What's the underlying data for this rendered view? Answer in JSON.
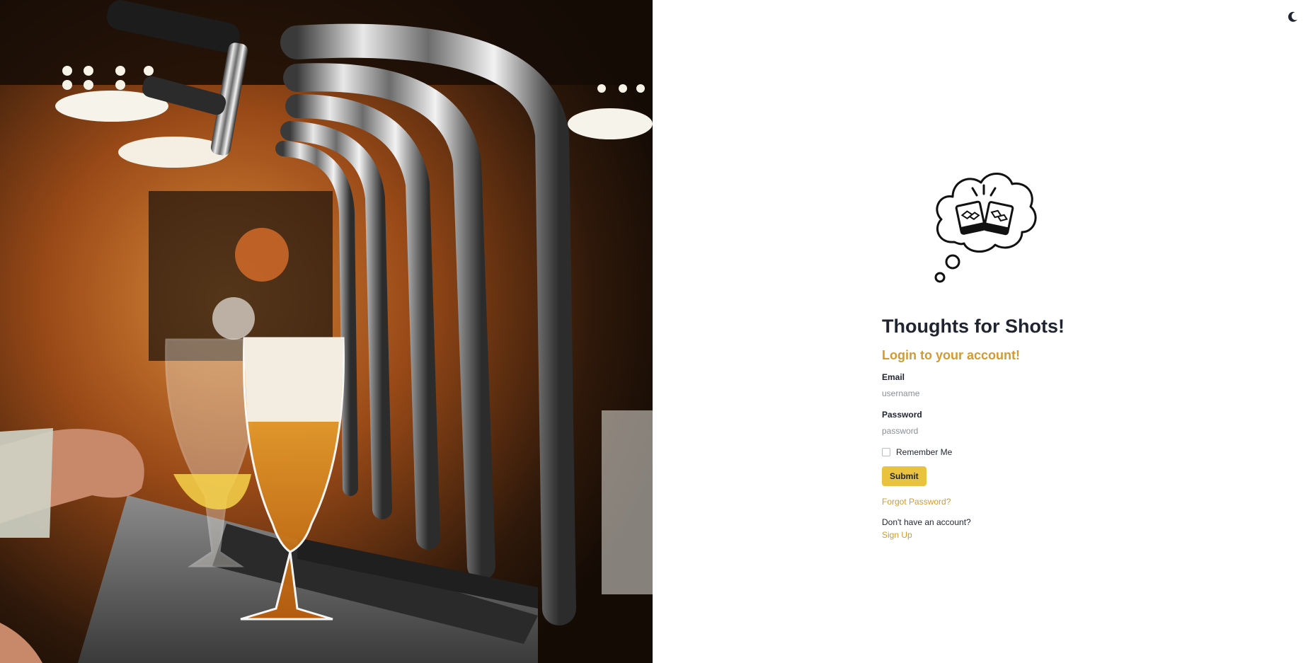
{
  "hero_image": {
    "subject": "beer-taps-with-glasses-photo"
  },
  "theme_toggle": {
    "icon": "moon-icon"
  },
  "logo": {
    "icon": "thought-bubble-cheers-icon"
  },
  "login": {
    "brand_title": "Thoughts for Shots!",
    "subtitle": "Login to your account!",
    "email_label": "Email",
    "email_placeholder": "username",
    "email_value": "",
    "password_label": "Password",
    "password_placeholder": "password",
    "password_value": "",
    "remember_label": "Remember Me",
    "remember_checked": false,
    "submit_label": "Submit",
    "forgot_label": "Forgot Password?",
    "no_account_text": "Don't have an account?",
    "signup_label": "Sign Up"
  },
  "colors": {
    "accent": "#d39a2f",
    "button_bg": "#e9c23e",
    "text_dark": "#1f2430",
    "placeholder": "#8a8f98"
  }
}
